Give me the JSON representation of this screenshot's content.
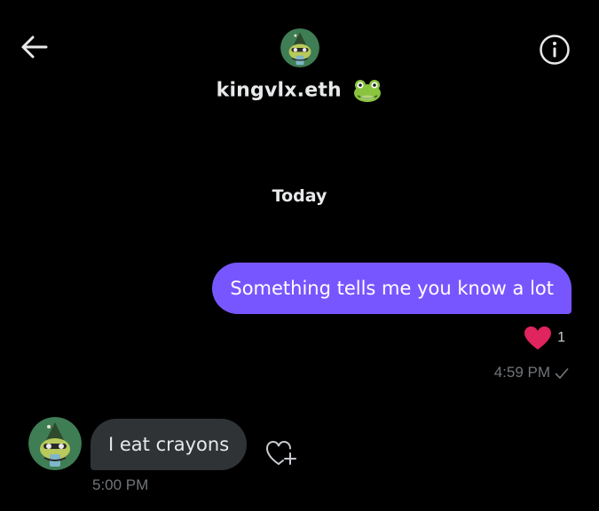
{
  "header": {
    "back_icon": "arrow-left-icon",
    "info_icon": "info-circle-icon",
    "avatar_icon": "frog-wizard-avatar",
    "name": "kingvlx.eth",
    "name_emoji_icon": "frog-face-emoji"
  },
  "conversation": {
    "date_separator": "Today",
    "messages": [
      {
        "direction": "sent",
        "text": "Something tells me you know a lot",
        "time": "4:59 PM",
        "reaction_icon": "heart-icon",
        "reaction_count": "1",
        "status_icon": "checkmark-icon"
      },
      {
        "direction": "received",
        "text": "I eat crayons",
        "time": "5:00 PM",
        "avatar_icon": "frog-wizard-avatar",
        "add_reaction_icon": "add-reaction-icon"
      }
    ]
  },
  "colors": {
    "background": "#000000",
    "sent_bubble": "#7856ff",
    "received_bubble": "#2f3336",
    "heart": "#e0245e",
    "muted_text": "#71767b",
    "primary_text": "#e7e9ea"
  }
}
